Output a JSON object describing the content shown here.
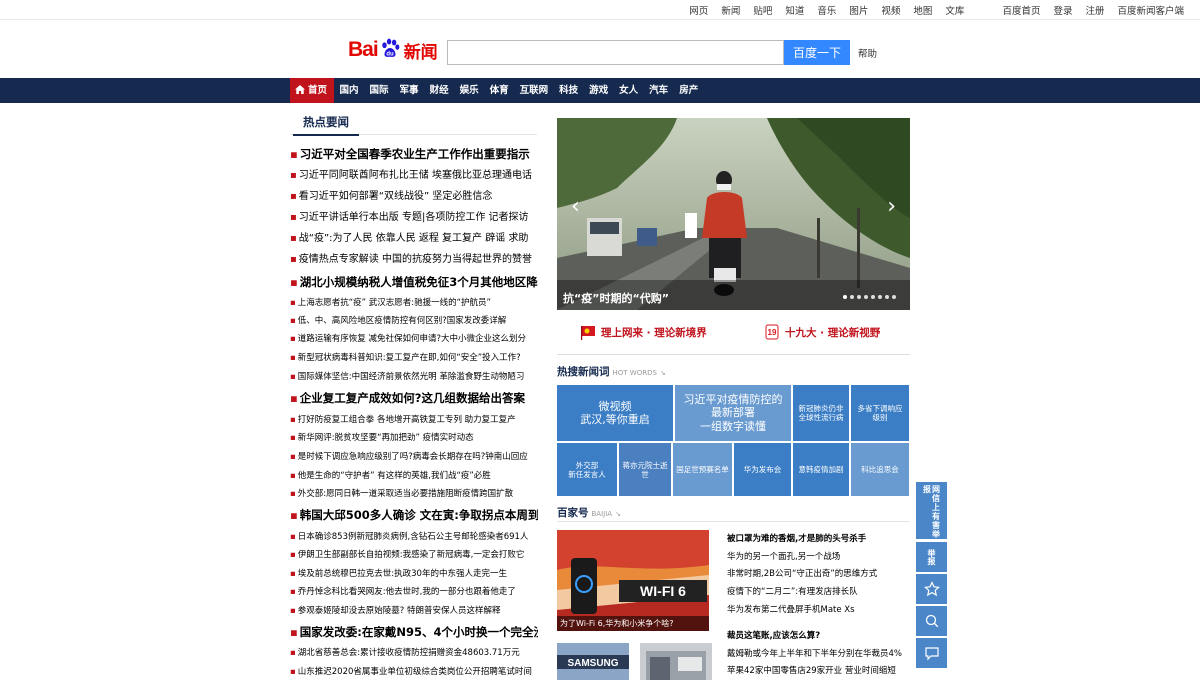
{
  "top_links": [
    "网页",
    "新闻",
    "贴吧",
    "知道",
    "音乐",
    "图片",
    "视频",
    "地图",
    "文库"
  ],
  "top_right_links": [
    "百度首页",
    "登录",
    "注册",
    "百度新闻客户端"
  ],
  "logo": {
    "brand": "Bai",
    "brand2": "du",
    "product": "新闻"
  },
  "search": {
    "value": "",
    "button": "百度一下",
    "help": "帮助"
  },
  "nav": [
    "首页",
    "国内",
    "国际",
    "军事",
    "财经",
    "娱乐",
    "体育",
    "互联网",
    "科技",
    "游戏",
    "女人",
    "汽车",
    "房产"
  ],
  "hot": {
    "title": "热点要闻",
    "items": [
      {
        "text": "习近平对全国春季农业生产工作作出重要指示",
        "style": "big"
      },
      {
        "text": "习近平同阿联酋阿布扎比王储 埃塞俄比亚总理通电话",
        "style": "mid"
      },
      {
        "text": "看习近平如何部署“双线战役” 坚定必胜信念",
        "style": "mid"
      },
      {
        "text": "习近平讲话单行本出版 专题|各项防控工作 记者探访",
        "style": "mid"
      },
      {
        "text": "战“疫”:为了人民 依靠人民 返程 复工复产 辟谣 求助",
        "style": "mid"
      },
      {
        "text": "疫情热点专家解读 中国的抗疫努力当得起世界的赞誉",
        "style": "mid"
      },
      {
        "text": "湖北小规模纳税人增值税免征3个月其他地区降至1%",
        "style": "big"
      },
      {
        "text": "上海志愿者抗“疫” 武汉志愿者:驰援一线的“护航员”",
        "style": "small"
      },
      {
        "text": "低、中、高风险地区疫情防控有何区别?国家发改委详解",
        "style": "small"
      },
      {
        "text": "道路运输有序恢复 减免社保如何申请?大中小微企业这么划分",
        "style": "small"
      },
      {
        "text": "新型冠状病毒科普知识:复工复产在即,如何“安全”投入工作?",
        "style": "small"
      },
      {
        "text": "国际媒体坚信:中国经济前景依然光明 革除滥食野生动物陋习",
        "style": "small"
      },
      {
        "text": "企业复工复产成效如何?这几组数据给出答案",
        "style": "big"
      },
      {
        "text": "打好防疫复工组合拳 各地增开高铁复工专列 助力复工复产",
        "style": "small"
      },
      {
        "text": "新华网评:脱贫攻坚要“再加把劲” 疫情实时动态",
        "style": "small"
      },
      {
        "text": "是时候下调应急响应级别了吗?病毒会长期存在吗?钟南山回应",
        "style": "small"
      },
      {
        "text": "他是生命的“守护者” 有这样的英雄,我们战“疫”必胜",
        "style": "small"
      },
      {
        "text": "外交部:愿同日韩一道采取适当必要措施阻断疫情跨国扩散",
        "style": "small"
      },
      {
        "text": "韩国大邱500多人确诊 文在寅:争取拐点本周到来",
        "style": "big"
      },
      {
        "text": "日本确诊853例新冠肺炎病例,含钻石公主号邮轮感染者691人",
        "style": "small"
      },
      {
        "text": "伊朗卫生部副部长自拍视频:我感染了新冠病毒,一定会打败它",
        "style": "small"
      },
      {
        "text": "埃及前总统穆巴拉克去世:执政30年的中东强人走完一生",
        "style": "small"
      },
      {
        "text": "乔丹悼念科比看哭网友:他去世时,我的一部分也跟着他走了",
        "style": "small"
      },
      {
        "text": "参观泰姬陵却没去原始陵墓? 特朗普安保人员这样解释",
        "style": "small"
      },
      {
        "text": "国家发改委:在家戴N95、4个小时换一个完全没必要",
        "style": "big"
      },
      {
        "text": "湖北省慈善总会:累计接收疫情防控捐赠资金48603.71万元",
        "style": "small"
      },
      {
        "text": "山东推迟2020省属事业单位初级综合类岗位公开招聘笔试时间",
        "style": "small"
      }
    ]
  },
  "slider": {
    "caption": "抗“疫”时期的“代购”",
    "prev": "‹",
    "next": "›"
  },
  "promo": [
    {
      "text": "理上网来 · 理论新境界"
    },
    {
      "text": "十九大 · 理论新视野"
    }
  ],
  "hotwords": {
    "title": "热搜新闻词",
    "subtitle": "HOT WORDS",
    "tiles": [
      {
        "text": "微视频\n武汉,等你重启",
        "color": "#3b7ec5"
      },
      {
        "text": "习近平对疫情防控的\n最新部署\n一组数字读懂",
        "color": "#6a9bd0"
      },
      {
        "text": "新冠肺炎仍非\n全球性流行病",
        "color": "#3b7ec5"
      },
      {
        "text": "多省下调响应\n级别",
        "color": "#3b7ec5"
      },
      {
        "text": "外交部\n新任发言人",
        "color": "#3b7ec5"
      },
      {
        "text": "蒋亦元院士逝世",
        "color": "#4b80c0"
      },
      {
        "text": "国足世预赛名单",
        "color": "#6a9bd0"
      },
      {
        "text": "华为发布会",
        "color": "#3b7ec5"
      },
      {
        "text": "意韩疫情加剧",
        "color": "#3b7ec5"
      },
      {
        "text": "科比追思会",
        "color": "#6a9bd0"
      }
    ]
  },
  "baijia": {
    "title": "百家号",
    "subtitle": "BAIJIA",
    "image_caption": "为了Wi-Fi 6,华为和小米争个啥?",
    "image_text": "WI-FI 6",
    "items": [
      {
        "text": "被口罩为难的香烟,才是肺的头号杀手",
        "bold": true
      },
      {
        "text": "华为的另一个面孔,另一个战场",
        "bold": false
      },
      {
        "text": "非常时期,2B公司“守正出奇”的思维方式",
        "bold": false
      },
      {
        "text": "疫情下的“二月二”:有理发店排长队",
        "bold": false
      },
      {
        "text": "华为发布第二代叠屏手机Mate Xs",
        "bold": false
      },
      {
        "text": "裁员这笔账,应该怎么算?",
        "bold": true
      },
      {
        "text": "戴姆勒或今年上半年和下半年分别在华裁员4%",
        "bold": false
      },
      {
        "text": "苹果42家中国零售店29家开业 营业时间缩短",
        "bold": false
      }
    ],
    "thumb1_text": "SAMSUNG"
  },
  "sidetools": {
    "feedback": "网信上有害举报",
    "report": "举报",
    "colors": {
      "blue": "#4a86c8"
    }
  },
  "colors": {
    "nav_bg": "#162a4f",
    "accent_red": "#c0131c",
    "search_btn": "#3388ff"
  }
}
